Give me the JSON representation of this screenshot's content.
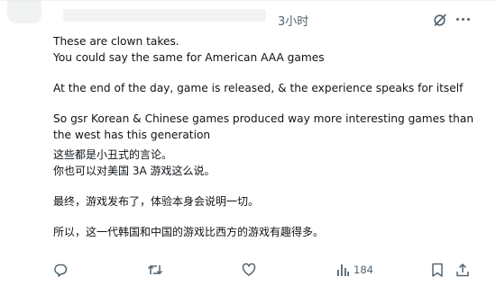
{
  "tweet": {
    "timestamp": "3小时",
    "lines_en_1": [
      "These are clown takes.",
      "You could say the same for American AAA games"
    ],
    "line_en_2": "At the end of the day, game is released, & the experience speaks for itself",
    "lines_en_3": [
      "So gsr Korean & Chinese games produced way more interesting games than",
      "the west has this generation"
    ],
    "lines_zh_1": [
      "这些都是小丑式的言论。",
      "你也可以对美国 3A 游戏这么说。"
    ],
    "line_zh_2": "最终，游戏发布了，体验本身会说明一切。",
    "line_zh_3": "所以，这一代韩国和中国的游戏比西方的游戏有趣得多。"
  },
  "actions": {
    "reply_icon": "reply-icon",
    "retweet_icon": "retweet-icon",
    "like_icon": "heart-icon",
    "views_icon": "views-chart-icon",
    "views_count": "184",
    "bookmark_icon": "bookmark-icon",
    "share_icon": "share-icon"
  },
  "colors": {
    "text": "#0f1419",
    "muted": "#536471",
    "border": "#eff3f4"
  }
}
